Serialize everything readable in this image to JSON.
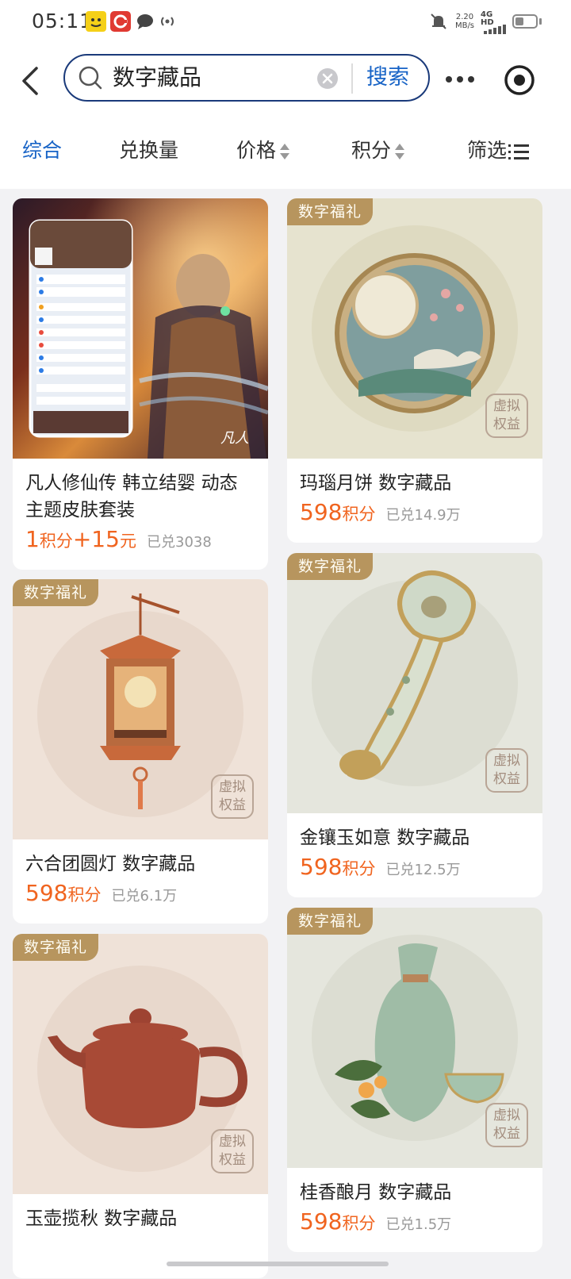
{
  "status_bar": {
    "time": "05:11",
    "speed_value": "2.20",
    "speed_unit": "MB/s",
    "network": "4G HD"
  },
  "search": {
    "query": "数字藏品",
    "button_label": "搜索"
  },
  "tabs": [
    {
      "label": "综合",
      "active": true
    },
    {
      "label": "兑换量",
      "active": false
    },
    {
      "label": "价格",
      "active": false
    },
    {
      "label": "积分",
      "active": false
    },
    {
      "label": "筛选",
      "active": false
    }
  ],
  "products": [
    {
      "title": "凡人修仙传 韩立结婴 动态主题皮肤套装",
      "price_num1": "1",
      "price_unit1": "积分",
      "price_plus": "+",
      "price_num2": "15",
      "price_unit2": "元",
      "sold": "已兑3038",
      "badge": "",
      "virtual_badge": ""
    },
    {
      "title": "玛瑙月饼 数字藏品",
      "price_num1": "598",
      "price_unit1": "积分",
      "sold": "已兑14.9万",
      "badge": "数字福礼",
      "virtual_badge": "虚拟权益"
    },
    {
      "title": "六合团圆灯 数字藏品",
      "price_num1": "598",
      "price_unit1": "积分",
      "sold": "已兑6.1万",
      "badge": "数字福礼",
      "virtual_badge": "虚拟权益"
    },
    {
      "title": "金镶玉如意 数字藏品",
      "price_num1": "598",
      "price_unit1": "积分",
      "sold": "已兑12.5万",
      "badge": "数字福礼",
      "virtual_badge": "虚拟权益"
    },
    {
      "title": "玉壶揽秋 数字藏品",
      "badge": "数字福礼",
      "virtual_badge": "虚拟权益"
    },
    {
      "title": "桂香酿月 数字藏品",
      "price_num1": "598",
      "price_unit1": "积分",
      "sold": "已兑1.5万",
      "badge": "数字福礼",
      "virtual_badge": "虚拟权益"
    }
  ],
  "skin_preview": {
    "brand_mark": "凡人"
  },
  "icons": {
    "back": "back-arrow-icon",
    "search": "search-icon",
    "clear": "clear-icon",
    "more": "more-icon",
    "target": "target-icon",
    "sort": "sort-arrows-icon",
    "filter": "filter-icon"
  },
  "colors": {
    "accent": "#1763c6",
    "price": "#f0641f",
    "badge": "#b7955e",
    "search_border": "#1a3a7a"
  }
}
